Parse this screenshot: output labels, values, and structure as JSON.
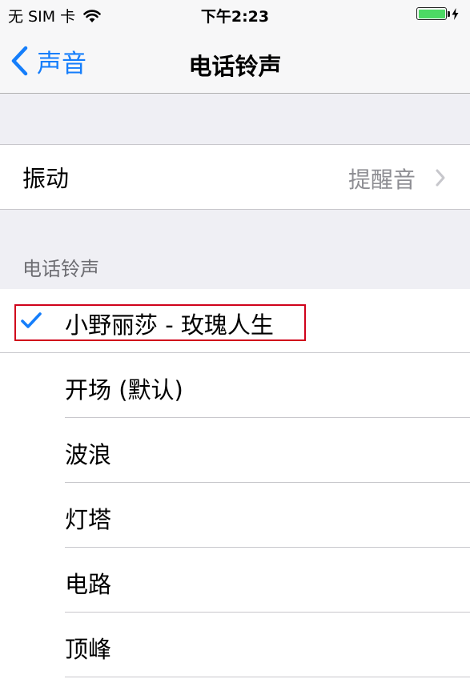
{
  "status_bar": {
    "carrier": "无 SIM 卡",
    "time": "下午2:23",
    "battery_level": 1.0,
    "battery_color": "#4cd964",
    "icons": [
      "wifi-icon",
      "battery-icon",
      "charging-bolt-icon"
    ]
  },
  "nav": {
    "back_label": "声音",
    "title": "电话铃声",
    "accent_color": "#157efb"
  },
  "vibration": {
    "label": "振动",
    "value": "提醒音"
  },
  "ringtones": {
    "section_header": "电话铃声",
    "selected_index": 0,
    "items": [
      {
        "label": "小野丽莎 - 玫瑰人生"
      },
      {
        "label": "开场 (默认)"
      },
      {
        "label": "波浪"
      },
      {
        "label": "灯塔"
      },
      {
        "label": "电路"
      },
      {
        "label": "顶峰"
      }
    ]
  },
  "annotation": {
    "highlight_color": "#d0021b"
  }
}
